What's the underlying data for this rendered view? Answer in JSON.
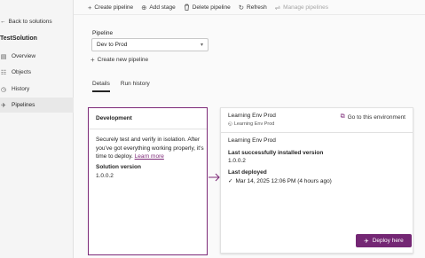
{
  "sidebar": {
    "back_label": "Back to solutions",
    "solution_title": "TestSolution",
    "items": [
      {
        "label": "Overview",
        "icon": "overview-icon"
      },
      {
        "label": "Objects",
        "icon": "objects-icon"
      },
      {
        "label": "History",
        "icon": "history-icon"
      },
      {
        "label": "Pipelines",
        "icon": "rocket-icon",
        "active": true
      }
    ]
  },
  "toolbar": {
    "create_pipeline": "Create pipeline",
    "add_stage": "Add stage",
    "delete_pipeline": "Delete pipeline",
    "refresh": "Refresh",
    "manage_pipelines": "Manage pipelines"
  },
  "pipeline": {
    "label": "Pipeline",
    "selected": "Dev to Prod",
    "create_new_label": "Create new pipeline"
  },
  "tabs": [
    {
      "label": "Details",
      "active": true
    },
    {
      "label": "Run history",
      "active": false
    }
  ],
  "development": {
    "title": "Development",
    "description": "Securely test and verify in isolation. After you've got everything working properly, it's time to deploy.",
    "learn_more": "Learn more",
    "version_label": "Solution version",
    "version": "1.0.0.2"
  },
  "target_env": {
    "name": "Learning Env Prod",
    "sub_name": "Learning Env Prod",
    "goto_label": "Go to this environment",
    "env_name": "Learning Env Prod",
    "installed_label": "Last successfully installed version",
    "installed_version": "1.0.0.2",
    "deployed_label": "Last deployed",
    "deployed_value": "Mar 14, 2025 12:06 PM (4 hours ago)",
    "deploy_button": "Deploy here"
  },
  "colors": {
    "accent": "#742774",
    "border_accent": "#7d2a78"
  }
}
